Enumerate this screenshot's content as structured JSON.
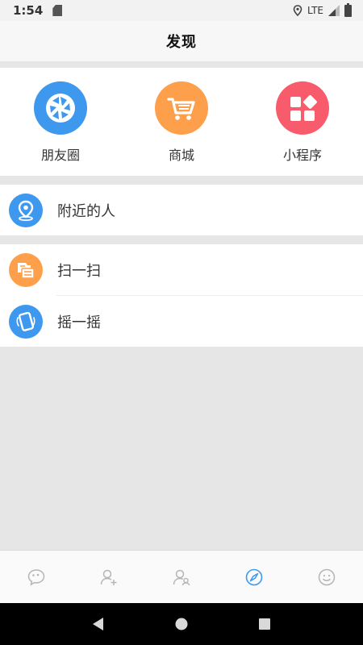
{
  "status_bar": {
    "time": "1:54",
    "network": "LTE"
  },
  "header": {
    "title": "发现"
  },
  "grid": [
    {
      "label": "朋友圈",
      "icon": "moments-aperture-icon",
      "color": "#3d98ee"
    },
    {
      "label": "商城",
      "icon": "shopping-cart-icon",
      "color": "#fe9f4b"
    },
    {
      "label": "小程序",
      "icon": "mini-program-icon",
      "color": "#f85c6c"
    }
  ],
  "list_nearby": {
    "label": "附近的人",
    "icon": "location-pin-icon",
    "color": "#3d98ee"
  },
  "list_tools": [
    {
      "label": "扫一扫",
      "icon": "scan-icon",
      "color": "#fe9f4b"
    },
    {
      "label": "摇一摇",
      "icon": "shake-phone-icon",
      "color": "#3d98ee"
    }
  ],
  "tab_bar": {
    "active_color": "#3d98ee",
    "inactive_color": "#b5b5b5",
    "tabs": [
      {
        "icon": "chat-icon",
        "active": false
      },
      {
        "icon": "add-contact-icon",
        "active": false
      },
      {
        "icon": "contacts-icon",
        "active": false
      },
      {
        "icon": "compass-icon",
        "active": true
      },
      {
        "icon": "smiley-icon",
        "active": false
      }
    ]
  }
}
